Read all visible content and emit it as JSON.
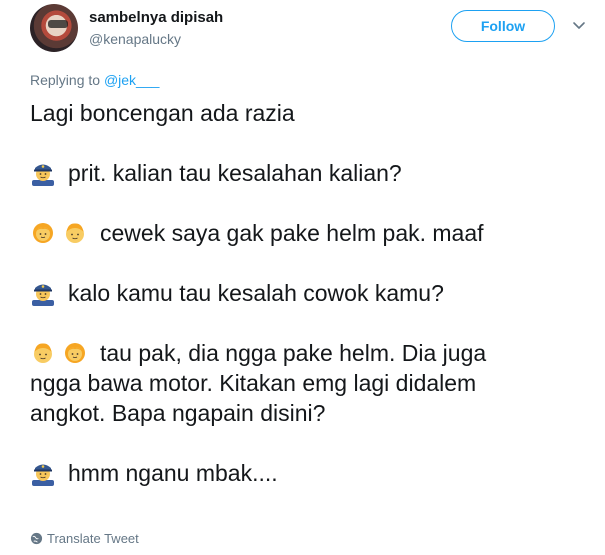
{
  "user": {
    "display_name": "sambelnya dipisah",
    "handle": "@kenapalucky"
  },
  "follow_label": "Follow",
  "replying": {
    "prefix": "Replying to",
    "mention": "@jek___"
  },
  "tweet": {
    "line1": "Lagi boncengan ada razia",
    "line2": "prit. kalian tau kesalahan kalian?",
    "line3": "cewek saya gak pake helm pak. maaf",
    "line4": "kalo kamu tau kesalah cowok kamu?",
    "line5a": "tau pak, dia ngga pake helm. Dia juga",
    "line5b": "ngga bawa motor. Kitakan emg lagi didalem",
    "line5c": "angkot. Bapa ngapain disini?",
    "line6": "hmm nganu mbak...."
  },
  "icons": {
    "police": "police-officer-icon",
    "girl": "girl-icon",
    "boy": "boy-icon",
    "globe": "globe-icon",
    "caret": "chevron-down-icon"
  },
  "translate_label": "Translate Tweet",
  "colors": {
    "accent": "#1da1f2",
    "muted": "#657786",
    "text": "#14171a"
  }
}
